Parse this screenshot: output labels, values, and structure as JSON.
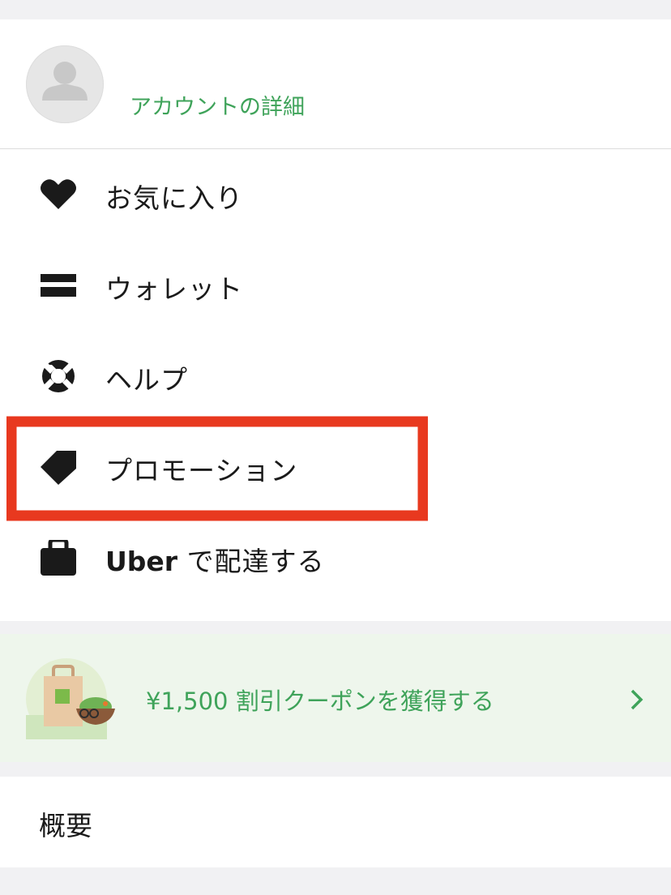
{
  "account": {
    "link_label": "アカウントの詳細"
  },
  "menu": {
    "items": [
      {
        "label": "お気に入り",
        "icon": "heart-icon"
      },
      {
        "label": "ウォレット",
        "icon": "wallet-card-icon"
      },
      {
        "label": "ヘルプ",
        "icon": "lifebuoy-icon"
      },
      {
        "label": "プロモーション",
        "icon": "tag-icon"
      },
      {
        "label_brand": "Uber",
        "label_rest": " で配達する",
        "icon": "bag-icon"
      }
    ]
  },
  "promo": {
    "text": "¥1,500 割引クーポンを獲得する",
    "icon": "chevron-right-icon"
  },
  "about": {
    "label": "概要"
  },
  "colors": {
    "accent_green": "#3fa35a",
    "promo_bg": "#eef6ec",
    "highlight_red": "#e8391f",
    "text": "#1a1a1a"
  }
}
